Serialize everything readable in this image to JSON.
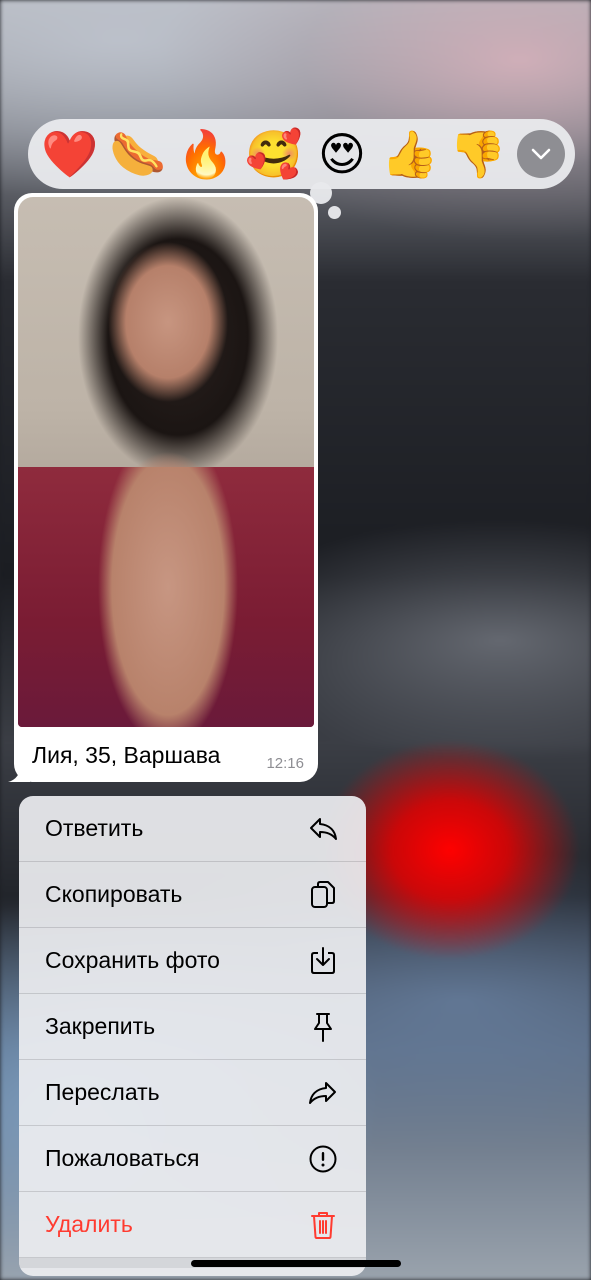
{
  "reactions": [
    {
      "emoji": "❤️",
      "name": "red-heart"
    },
    {
      "emoji": "🌭",
      "name": "hot-dog"
    },
    {
      "emoji": "🔥",
      "name": "fire"
    },
    {
      "emoji": "🥰",
      "name": "smiling-face-with-hearts"
    },
    {
      "emoji": "😍",
      "name": "heart-eyes"
    },
    {
      "emoji": "👍",
      "name": "thumbs-up"
    },
    {
      "emoji": "👎",
      "name": "thumbs-down"
    }
  ],
  "message": {
    "caption": "Лия, 35, Варшава",
    "time": "12:16"
  },
  "menu": {
    "reply": "Ответить",
    "copy": "Скопировать",
    "save_photo": "Сохранить фото",
    "pin": "Закрепить",
    "forward": "Переслать",
    "report": "Пожаловаться",
    "delete": "Удалить"
  },
  "colors": {
    "destructive": "#ff3b30",
    "menu_bg": "#ecedf0",
    "time": "#8e8e93"
  }
}
